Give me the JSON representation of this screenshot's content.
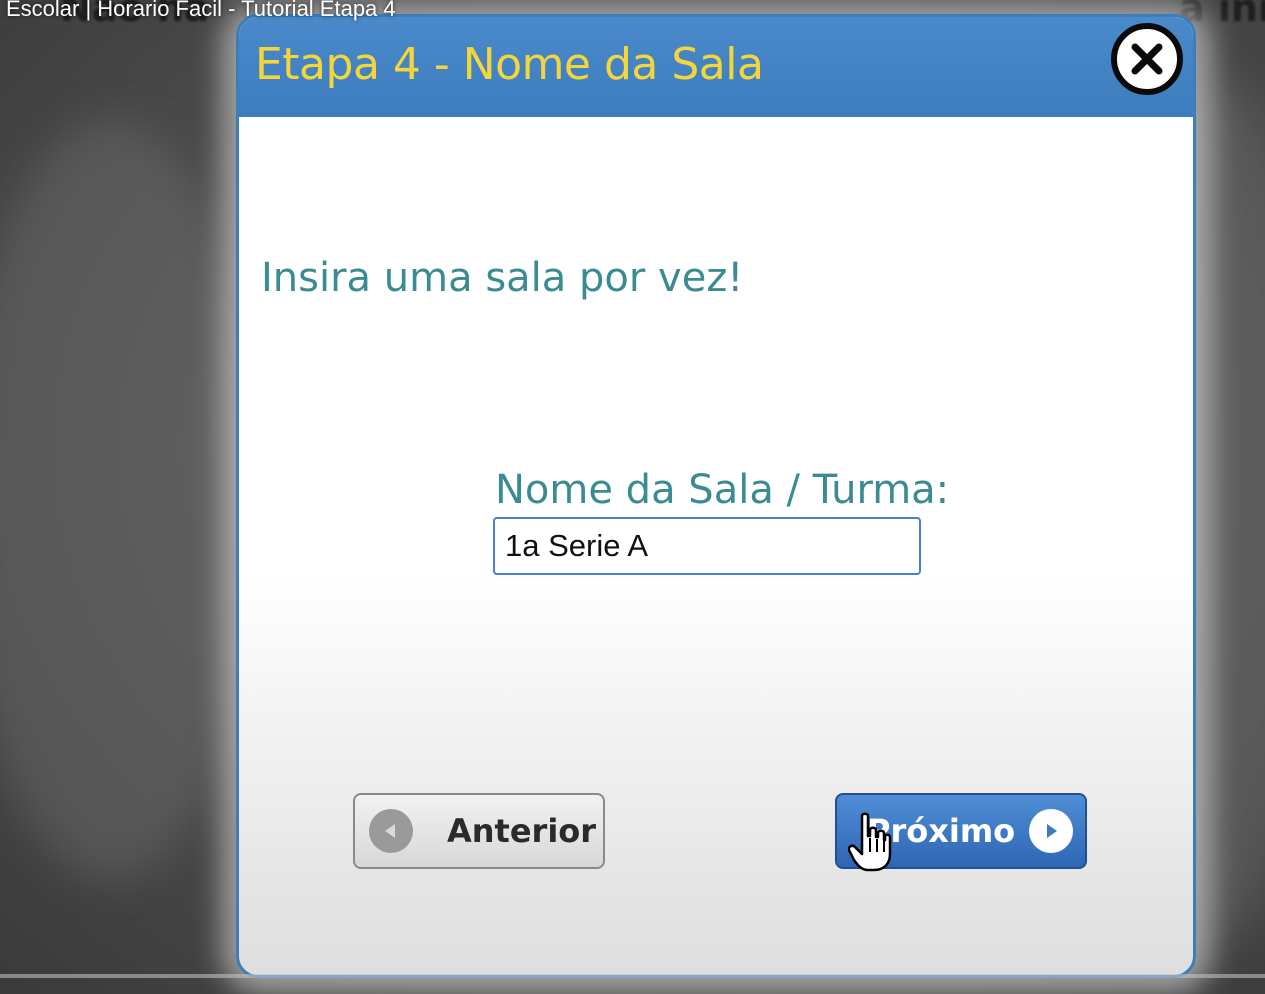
{
  "video": {
    "title": "Escolar | Horario Facil - Tutorial Etapa 4",
    "bg_text_left": "Não ha",
    "bg_text_right": "a ini",
    "progress": 0
  },
  "dialog": {
    "title": "Etapa 4 - Nome da Sala",
    "close_icon": "close-circle-icon",
    "instruction": "Insira uma sala por vez!",
    "field_label": "Nome da Sala / Turma:",
    "field_value": "1a Serie A",
    "prev_button": "Anterior",
    "next_button": "Próximo"
  },
  "colors": {
    "header_blue": "#3d7cbd",
    "title_yellow": "#f5d63a",
    "text_teal": "#3b8b93",
    "next_button_blue": "#2f66b4"
  }
}
